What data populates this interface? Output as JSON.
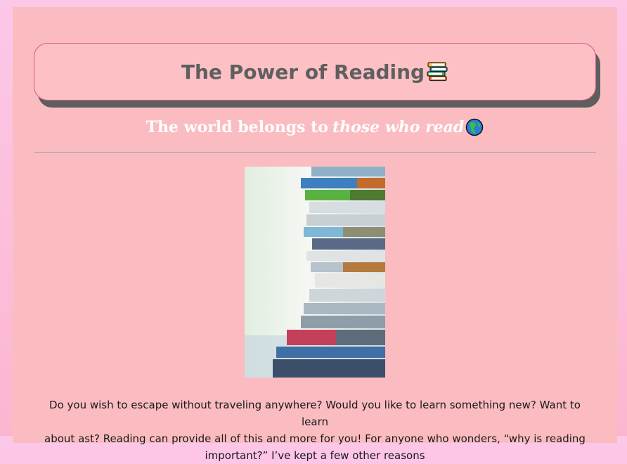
{
  "header": {
    "title": "The Power of Reading"
  },
  "subtitle": {
    "lead": "The world belongs to",
    "emphasis": "those who read"
  },
  "icons": {
    "title_icon": "books-icon",
    "subtitle_icon": "globe-icon"
  },
  "hero_image": {
    "subject": "stack-of-books-photo"
  },
  "intro": {
    "line1": "Do you wish to escape without traveling anywhere? Would you like to learn something new? Want to learn",
    "line2": "about ast? Reading can provide all of this and more for you! For anyone who wonders, “why is reading",
    "line3": "important?” I’ve kept a few other reasons"
  },
  "colors": {
    "background": "#fbbcc1",
    "title_text": "#5f5f5f",
    "title_border": "#d85a88",
    "shadow": "#5e5e5e",
    "subtitle_text": "#ffffff"
  }
}
